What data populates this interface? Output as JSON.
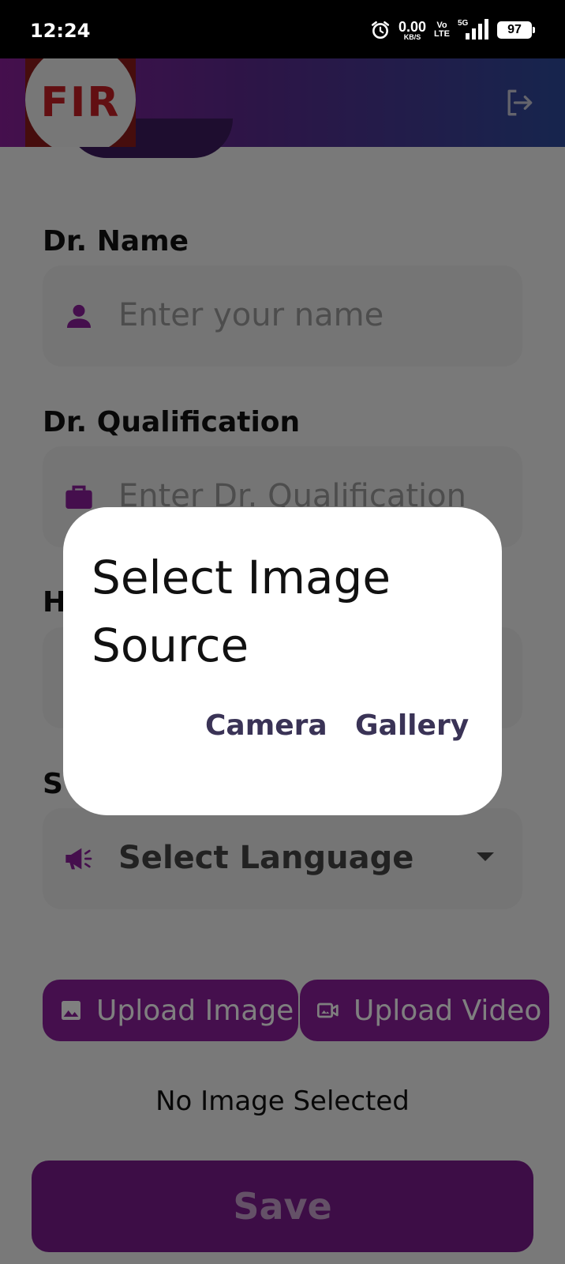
{
  "status_bar": {
    "time": "12:24",
    "net_speed_value": "0.00",
    "net_speed_unit": "KB/S",
    "volte_top": "Vo",
    "volte_bottom": "LTE",
    "network_type": "5G",
    "battery": "97",
    "icons": [
      "alarm-icon",
      "signal-icon",
      "battery-icon"
    ]
  },
  "header": {
    "logo_text": "FIR",
    "icons": [
      "logout-icon"
    ]
  },
  "form": {
    "name_label": "Dr. Name",
    "name_placeholder": "Enter your name",
    "qualification_label": "Dr. Qualification",
    "qualification_placeholder": "Enter Dr. Qualification",
    "hospital_label_partial": "H",
    "language_label_partial": "S",
    "language_select": "Select Language",
    "icons": [
      "person-icon",
      "briefcase-icon",
      "megaphone-icon",
      "chevron-down-icon"
    ]
  },
  "uploads": {
    "image_label": "Upload Image",
    "video_label": "Upload Video",
    "status": "No Image Selected",
    "icons": [
      "image-icon",
      "video-icon"
    ]
  },
  "save_label": "Save",
  "dialog": {
    "title_line1": "Select Image",
    "title_line2": "Source",
    "camera_label": "Camera",
    "gallery_label": "Gallery"
  },
  "colors": {
    "accent": "#8a1f9a",
    "header_gradient_start": "#8a1f9a",
    "header_gradient_end": "#2d4a9b",
    "logo_red": "#c41e24",
    "dialog_button_text": "#3a3356"
  }
}
